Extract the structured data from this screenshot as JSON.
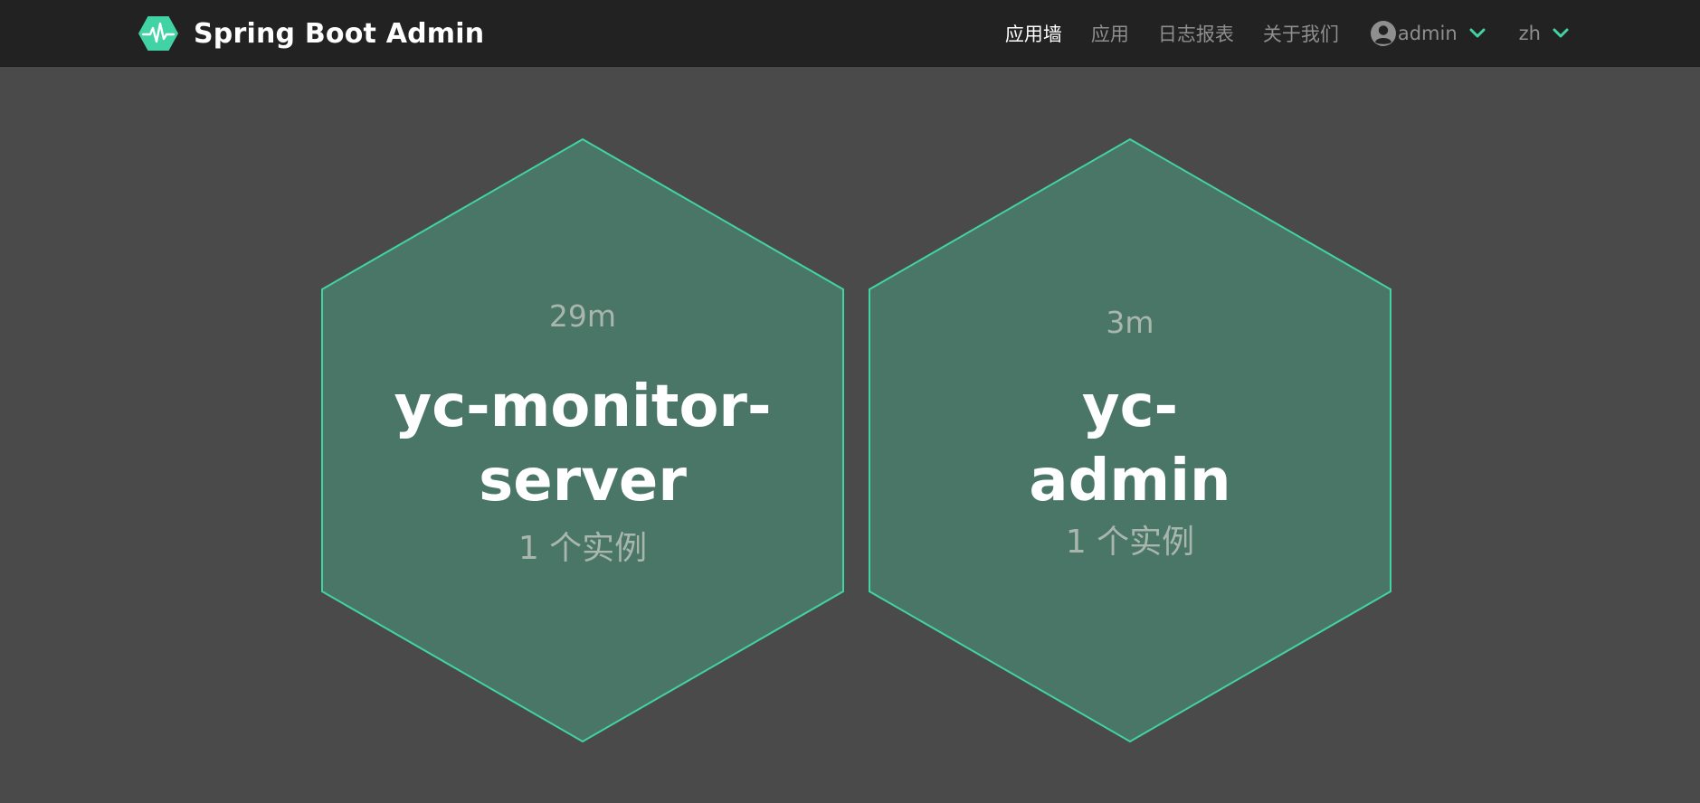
{
  "app": {
    "title": "Spring Boot Admin",
    "logo_icon": "heartbeat-hexagon-icon",
    "accent_color": "#42d3a5"
  },
  "nav": {
    "items": [
      {
        "label": "应用墙",
        "active": true
      },
      {
        "label": "应用",
        "active": false
      },
      {
        "label": "日志报表",
        "active": false
      },
      {
        "label": "关于我们",
        "active": false
      }
    ],
    "user": {
      "icon": "user-circle-icon",
      "name": "admin",
      "dropdown_icon": "chevron-down-icon"
    },
    "language": {
      "value": "zh",
      "dropdown_icon": "chevron-down-icon"
    }
  },
  "applications": [
    {
      "uptime": "29m",
      "name_lines": [
        "yc-monitor-",
        "server"
      ],
      "instances": "1 个实例",
      "status_color": "#42d3a5"
    },
    {
      "uptime": "3m",
      "name_lines": [
        "yc-",
        "admin"
      ],
      "instances": "1 个实例",
      "status_color": "#42d3a5"
    }
  ]
}
